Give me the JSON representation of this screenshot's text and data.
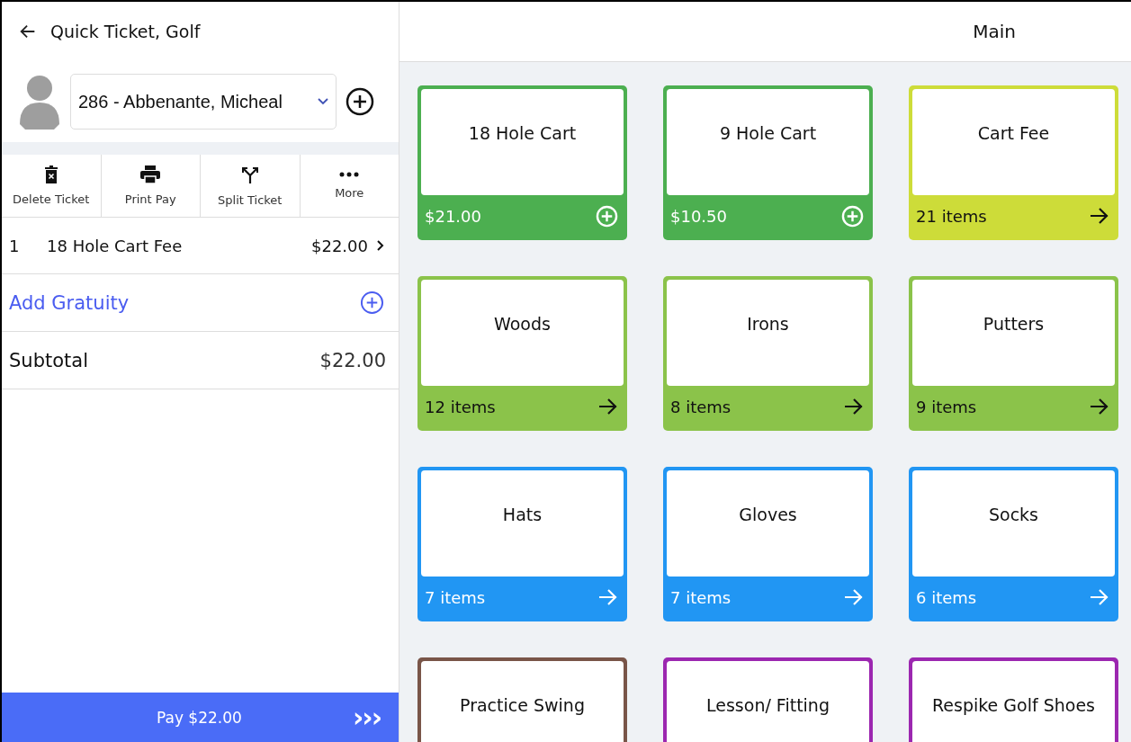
{
  "ticket": {
    "title": "Quick Ticket, Golf",
    "customer": "286 - Abbenante, Micheal",
    "actions": [
      {
        "label": "Delete Ticket",
        "kind": "delete"
      },
      {
        "label": "Print Pay",
        "kind": "print"
      },
      {
        "label": "Split Ticket",
        "kind": "split"
      },
      {
        "label": "More",
        "kind": "more"
      }
    ],
    "line_items": [
      {
        "qty": "1",
        "name": "18 Hole Cart Fee",
        "price": "$22.00"
      }
    ],
    "gratuity": "Add Gratuity",
    "subtotal": {
      "label": "Subtotal",
      "value": "$22.00"
    },
    "pay_button": {
      "label": "Pay $22.00",
      "icon": "›››"
    }
  },
  "main": {
    "title": "Main",
    "tiles": [
      {
        "name": "18 Hole Cart",
        "kind": "price",
        "footer": "$21.00",
        "color": "#4caf50"
      },
      {
        "name": "9 Hole Cart",
        "kind": "price",
        "footer": "$10.50",
        "color": "#4caf50"
      },
      {
        "name": "Cart Fee",
        "kind": "category",
        "footer": "21 items",
        "color": "#cddc39"
      },
      {
        "name": "Woods",
        "kind": "category",
        "footer": "12 items",
        "color": "#8bc34a"
      },
      {
        "name": "Irons",
        "kind": "category",
        "footer": "8 items",
        "color": "#8bc34a"
      },
      {
        "name": "Putters",
        "kind": "category",
        "footer": "9 items",
        "color": "#8bc34a"
      },
      {
        "name": "Hats",
        "kind": "category",
        "footer": "7 items",
        "color": "#2196f3"
      },
      {
        "name": "Gloves",
        "kind": "category",
        "footer": "7 items",
        "color": "#2196f3"
      },
      {
        "name": "Socks",
        "kind": "category",
        "footer": "6 items",
        "color": "#2196f3"
      },
      {
        "name": "Practice Swing",
        "color": "#795548"
      },
      {
        "name": "Lesson/ Fitting",
        "color": "#9c27b0"
      },
      {
        "name": "Respike Golf Shoes",
        "color": "#9c27b0"
      }
    ]
  }
}
